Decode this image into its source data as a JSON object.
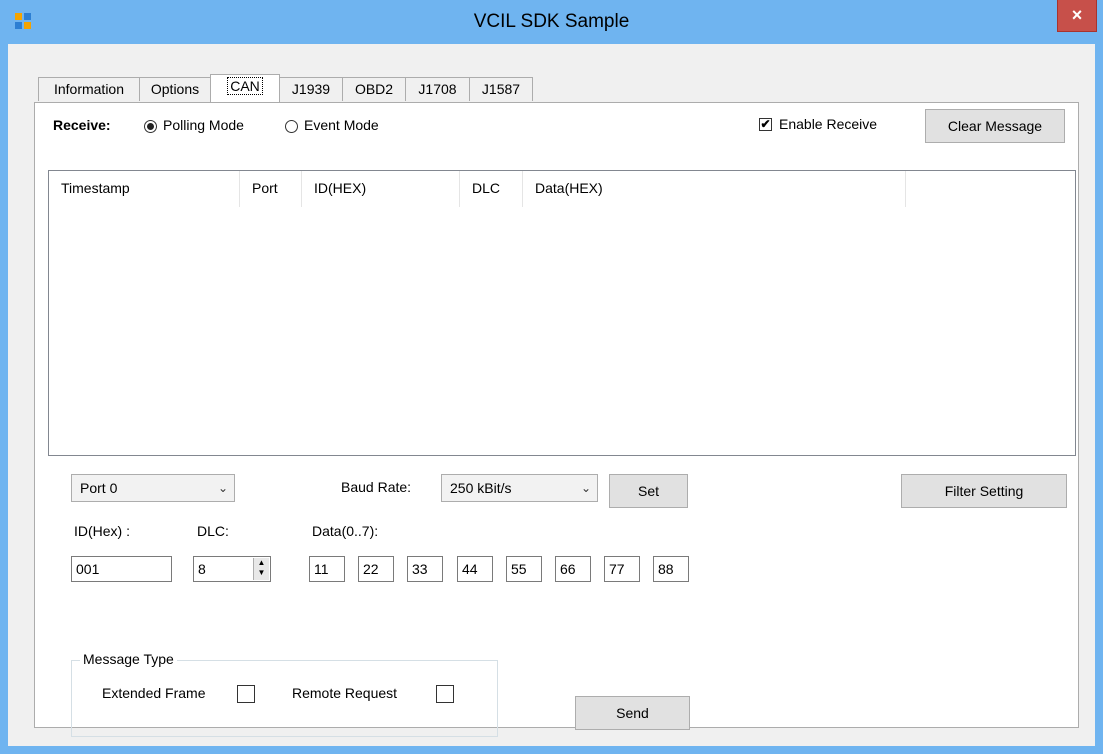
{
  "window": {
    "title": "VCIL SDK Sample",
    "close_glyph": "×"
  },
  "tabs": [
    {
      "label": "Information"
    },
    {
      "label": "Options"
    },
    {
      "label": "CAN"
    },
    {
      "label": "J1939"
    },
    {
      "label": "OBD2"
    },
    {
      "label": "J1708"
    },
    {
      "label": "J1587"
    }
  ],
  "receive": {
    "label": "Receive:",
    "polling_label": "Polling Mode",
    "event_label": "Event Mode",
    "selected": "Polling Mode",
    "enable_label": "Enable Receive",
    "enable_checked": true,
    "clear_button": "Clear Message"
  },
  "list": {
    "columns": [
      "Timestamp",
      "Port",
      "ID(HEX)",
      "DLC",
      "Data(HEX)",
      ""
    ],
    "rows": []
  },
  "port_select": {
    "value": "Port 0"
  },
  "baud": {
    "label": "Baud Rate:",
    "value": "250 kBit/s",
    "set_button": "Set"
  },
  "filter_button": "Filter Setting",
  "message": {
    "id_label": "ID(Hex) :",
    "id_value": "001",
    "dlc_label": "DLC:",
    "dlc_value": "8",
    "data_label": "Data(0..7):",
    "data": [
      "11",
      "22",
      "33",
      "44",
      "55",
      "66",
      "77",
      "88"
    ]
  },
  "message_type": {
    "title": "Message Type",
    "extended_label": "Extended Frame",
    "extended_checked": false,
    "remote_label": "Remote Request",
    "remote_checked": false
  },
  "send_button": "Send",
  "colors": {
    "titlebar": "#6fb4f0",
    "close": "#c7504a",
    "client": "#f0f0f0"
  }
}
